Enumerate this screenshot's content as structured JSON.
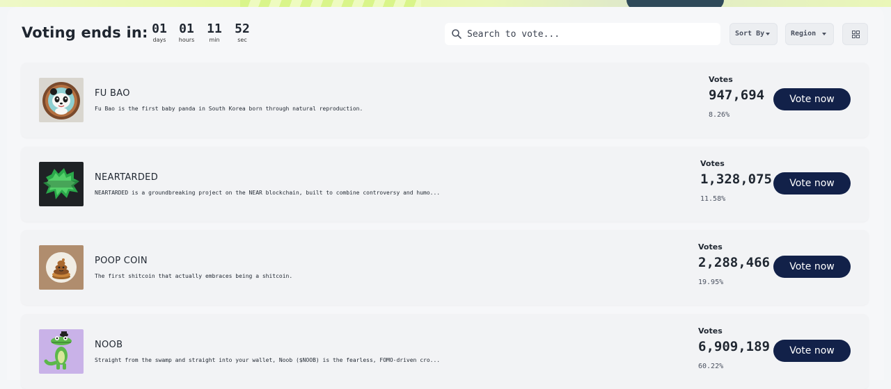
{
  "countdown": {
    "title": "Voting ends in:",
    "units": [
      {
        "value": "01",
        "label": "days"
      },
      {
        "value": "01",
        "label": "hours"
      },
      {
        "value": "11",
        "label": "min"
      },
      {
        "value": "52",
        "label": "sec"
      }
    ]
  },
  "search": {
    "placeholder": "Search to vote...",
    "value": ""
  },
  "filters": {
    "sort_label": "Sort By",
    "region_label": "Region"
  },
  "icons": {
    "search": "search-icon",
    "grid": "grid-view-icon",
    "caret": "chevron-down-icon"
  },
  "colors": {
    "button": "#122149",
    "background": "#f4f6f8"
  },
  "entries": [
    {
      "name": "FU BAO",
      "description": "Fu Bao is the first baby panda in South Korea born through natural reproduction.",
      "votes_label": "Votes",
      "votes": "947,694",
      "percent": "8.26%",
      "button_label": "Vote now",
      "image": "panda-coin-icon"
    },
    {
      "name": "NEARTARDED",
      "description": "NEARTARDED is a groundbreaking project on the NEAR blockchain, built to combine controversy and humo...",
      "votes_label": "Votes",
      "votes": "1,328,075",
      "percent": "11.58%",
      "button_label": "Vote now",
      "image": "neartarded-logo"
    },
    {
      "name": "POOP COIN",
      "description": "The first shitcoin that actually embraces being a shitcoin.",
      "votes_label": "Votes",
      "votes": "2,288,466",
      "percent": "19.95%",
      "button_label": "Vote now",
      "image": "poop-coin-icon"
    },
    {
      "name": "NOOB",
      "description": "Straight from the swamp and straight into your wallet, Noob ($NOOB) is the fearless, FOMO-driven cro...",
      "votes_label": "Votes",
      "votes": "6,909,189",
      "percent": "60.22%",
      "button_label": "Vote now",
      "image": "crocodile-mascot-icon"
    }
  ]
}
